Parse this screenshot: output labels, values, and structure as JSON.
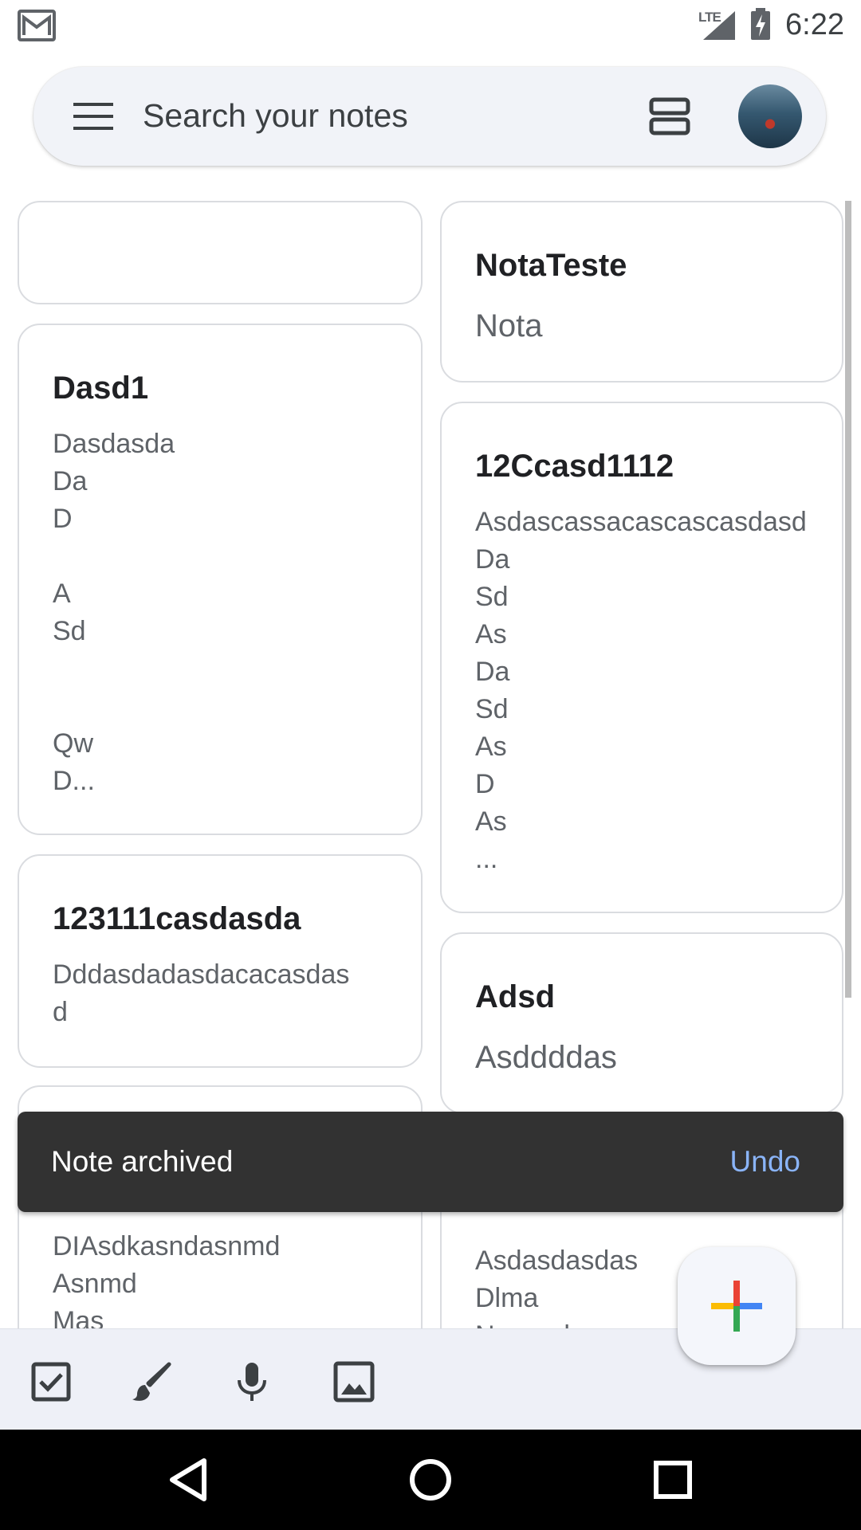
{
  "status_bar": {
    "network": "LTE",
    "time": "6:22",
    "icons": [
      "gmail-icon",
      "signal-icon",
      "battery-charging-icon"
    ]
  },
  "search": {
    "placeholder": "Search your notes",
    "icons": [
      "menu-icon",
      "grid-layout-icon",
      "account-avatar"
    ]
  },
  "notes": [
    {
      "title": "",
      "body": ""
    },
    {
      "title": "Dasd1",
      "body": "Dasdasda\nDa\nD\n\nA\nSd\n\n\nQw\nD..."
    },
    {
      "title": "123111casdasda",
      "body": "Dddasdadasdacacasdas\nd"
    },
    {
      "title": "",
      "body": "DIAsdkasndasnmd\nAsnmd\nMas"
    },
    {
      "title": "NotaTeste",
      "body": "Nota"
    },
    {
      "title": "12Ccasd1112",
      "body": "Asdascassacascascasdasd\nDa\nSd\nAs\nDa\nSd\nAs\nD\nAs\n..."
    },
    {
      "title": "Adsd",
      "body": "Asddddas"
    },
    {
      "title": "",
      "body": "Asdasdasdas\nDlma\nNcvmwk c"
    }
  ],
  "snackbar": {
    "message": "Note archived",
    "action": "Undo"
  },
  "bottom_bar": {
    "tools": [
      "checkbox-icon",
      "brush-icon",
      "mic-icon",
      "image-icon"
    ],
    "fab": "add-icon"
  },
  "nav_bar": {
    "buttons": [
      "back-icon",
      "home-icon",
      "recents-icon"
    ]
  }
}
